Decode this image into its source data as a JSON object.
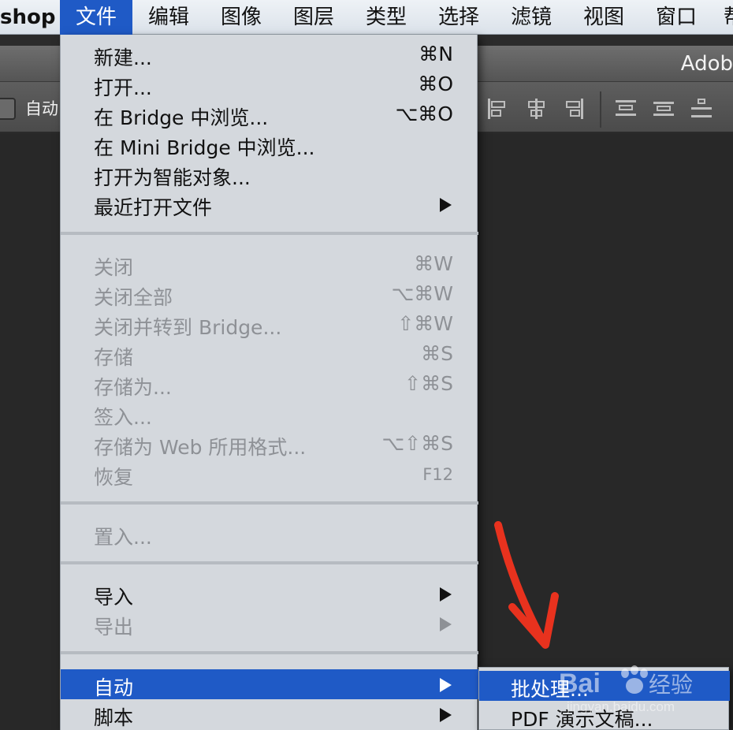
{
  "menubar": {
    "app": "shop",
    "items": [
      "文件",
      "编辑",
      "图像",
      "图层",
      "类型",
      "选择",
      "滤镜",
      "视图",
      "窗口",
      "帮"
    ]
  },
  "titlebar": {
    "title": "Adob"
  },
  "optionsbar": {
    "auto_label": "自动"
  },
  "menu": {
    "g1": [
      {
        "label": "新建...",
        "shortcut": "⌘N"
      },
      {
        "label": "打开...",
        "shortcut": "⌘O"
      },
      {
        "label": "在 Bridge 中浏览...",
        "shortcut": "⌥⌘O"
      },
      {
        "label": "在 Mini Bridge 中浏览...",
        "shortcut": ""
      },
      {
        "label": "打开为智能对象...",
        "shortcut": ""
      },
      {
        "label": "最近打开文件",
        "shortcut": ""
      }
    ],
    "g2": [
      {
        "label": "关闭",
        "shortcut": "⌘W"
      },
      {
        "label": "关闭全部",
        "shortcut": "⌥⌘W"
      },
      {
        "label": "关闭并转到 Bridge...",
        "shortcut": "⇧⌘W"
      },
      {
        "label": "存储",
        "shortcut": "⌘S"
      },
      {
        "label": "存储为...",
        "shortcut": "⇧⌘S"
      },
      {
        "label": "签入...",
        "shortcut": ""
      },
      {
        "label": "存储为 Web 所用格式...",
        "shortcut": "⌥⇧⌘S"
      },
      {
        "label": "恢复",
        "shortcut": "F12"
      }
    ],
    "g3": [
      {
        "label": "置入...",
        "shortcut": ""
      }
    ],
    "g4": [
      {
        "label": "导入",
        "shortcut": ""
      },
      {
        "label": "导出",
        "shortcut": ""
      }
    ],
    "g5": [
      {
        "label": "自动",
        "shortcut": ""
      },
      {
        "label": "脚本",
        "shortcut": ""
      }
    ]
  },
  "submenu": {
    "items": [
      {
        "label": "批处理..."
      },
      {
        "label": "PDF 演示文稿..."
      }
    ]
  },
  "watermark": {
    "brand": "Bai",
    "brand_suffix": "经验",
    "url": "jingyan.baidu.com"
  },
  "colors": {
    "highlight": "#1f5ac6",
    "annotation_arrow": "#e8321e"
  }
}
